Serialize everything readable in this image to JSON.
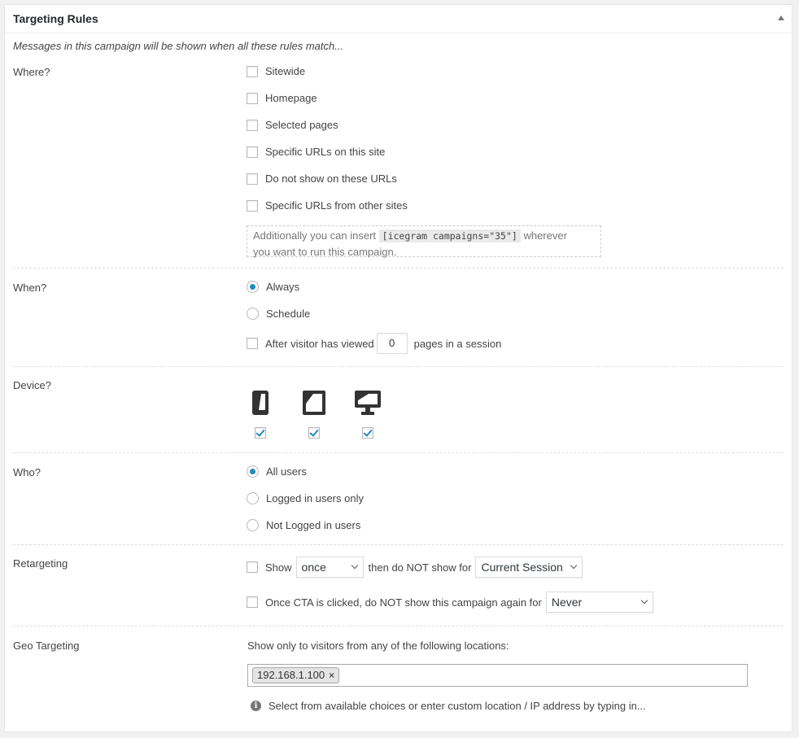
{
  "panel": {
    "title": "Targeting Rules",
    "intro": "Messages in this campaign will be shown when all these rules match..."
  },
  "where": {
    "label": "Where?",
    "options": [
      {
        "label": "Sitewide",
        "checked": false
      },
      {
        "label": "Homepage",
        "checked": false
      },
      {
        "label": "Selected pages",
        "checked": false
      },
      {
        "label": "Specific URLs on this site",
        "checked": false
      },
      {
        "label": "Do not show on these URLs",
        "checked": false
      },
      {
        "label": "Specific URLs from other sites",
        "checked": false
      }
    ],
    "note_prefix": "Additionally you can insert",
    "shortcode": "[icegram campaigns=\"35\"]",
    "note_suffix": "wherever",
    "note_line2": "you want to run this campaign."
  },
  "when": {
    "label": "When?",
    "always": "Always",
    "schedule": "Schedule",
    "selected": "Always",
    "after_prefix": "After visitor has viewed",
    "pages_value": "0",
    "after_suffix": "pages in a session"
  },
  "device": {
    "label": "Device?",
    "items": [
      {
        "icon": "mobile-icon",
        "checked": true
      },
      {
        "icon": "tablet-icon",
        "checked": true
      },
      {
        "icon": "desktop-icon",
        "checked": true
      }
    ]
  },
  "who": {
    "label": "Who?",
    "options": [
      "All users",
      "Logged in users only",
      "Not Logged in users"
    ],
    "selected": "All users"
  },
  "retargeting": {
    "label": "Retargeting",
    "show_label": "Show",
    "frequency_value": "once",
    "middle_text": "then do NOT show for",
    "duration_value": "Current Session",
    "cta_label": "Once CTA is clicked, do NOT show this campaign again for",
    "cta_value": "Never"
  },
  "geo": {
    "label": "Geo Targeting",
    "description": "Show only to visitors from any of the following locations:",
    "tags": [
      "192.168.1.100"
    ],
    "remove_symbol": "×",
    "info_symbol": "i",
    "help": "Select from available choices or enter custom location / IP address by typing in..."
  },
  "colors": {
    "accent": "#1e8cbe",
    "text": "#444444",
    "divider": "#dddddd"
  }
}
